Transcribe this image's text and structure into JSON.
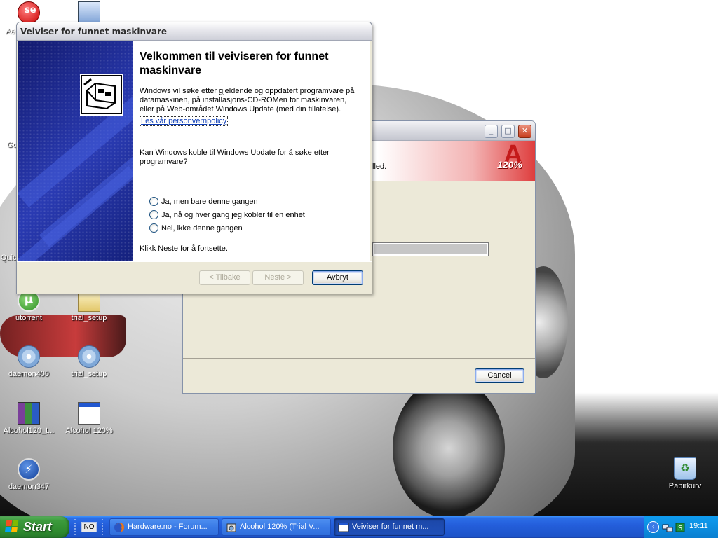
{
  "desktop": {
    "icons": [
      {
        "label": "utorrent",
        "icon": "utorrent-icon"
      },
      {
        "label": "trial_setup",
        "icon": "setup-icon"
      },
      {
        "label": "daemon400",
        "icon": "daemon-tools-icon"
      },
      {
        "label": "trial_setup",
        "icon": "setup-cd-icon"
      },
      {
        "label": "Alcohol120_t...",
        "icon": "winrar-archive-icon"
      },
      {
        "label": "Alcohol 120%",
        "icon": "application-window-icon"
      },
      {
        "label": "daemon347",
        "icon": "daemon-lightning-icon"
      },
      {
        "label": "Papirkurv",
        "icon": "recycle-bin-icon"
      }
    ],
    "partial_labels": [
      "Ae",
      "Go",
      "Quic"
    ]
  },
  "alcohol_window": {
    "header_text": "lled.",
    "logo_text": "120%",
    "progress_fraction": 1.0,
    "cancel_label": "Cancel",
    "controls": {
      "minimize": "_",
      "maximize": "□",
      "close": "✕"
    }
  },
  "wizard": {
    "title": "Veiviser for funnet maskinvare",
    "heading": "Velkommen til veiviseren for funnet maskinvare",
    "intro": "Windows vil søke etter gjeldende og oppdatert programvare på datamaskinen, på installasjons-CD-ROMen for maskinvaren, eller på Web-området Windows Update (med din tillatelse).",
    "privacy_link": "Les vår personvernpolicy",
    "question": "Kan Windows koble til Windows Update for å søke etter programvare?",
    "options": [
      "Ja, men bare denne gangen",
      "Ja, nå og hver gang jeg kobler til en enhet",
      "Nei, ikke denne gangen"
    ],
    "continue_text": "Klikk Neste for å fortsette.",
    "buttons": {
      "back": "< Tilbake",
      "next": "Neste >",
      "cancel": "Avbryt"
    }
  },
  "taskbar": {
    "start_label": "Start",
    "language": "NO",
    "tasks": [
      {
        "label": "Hardware.no - Forum...",
        "icon": "firefox-icon",
        "active": false
      },
      {
        "label": "Alcohol 120% (Trial V...",
        "icon": "alcohol-setup-icon",
        "active": false
      },
      {
        "label": "Veiviser for funnet m...",
        "icon": "wizard-window-icon",
        "active": true
      }
    ],
    "tray_icons": [
      "expand-tray-icon",
      "network-icon",
      "security-icon"
    ],
    "clock": "19:11"
  },
  "colors": {
    "taskbar_blue": "#245edb",
    "start_green": "#3c9b3c",
    "wizard_sidebar_blue": "#1d2a8d",
    "alcohol_red": "#c41a1a",
    "link_blue": "#0f3fb8"
  }
}
